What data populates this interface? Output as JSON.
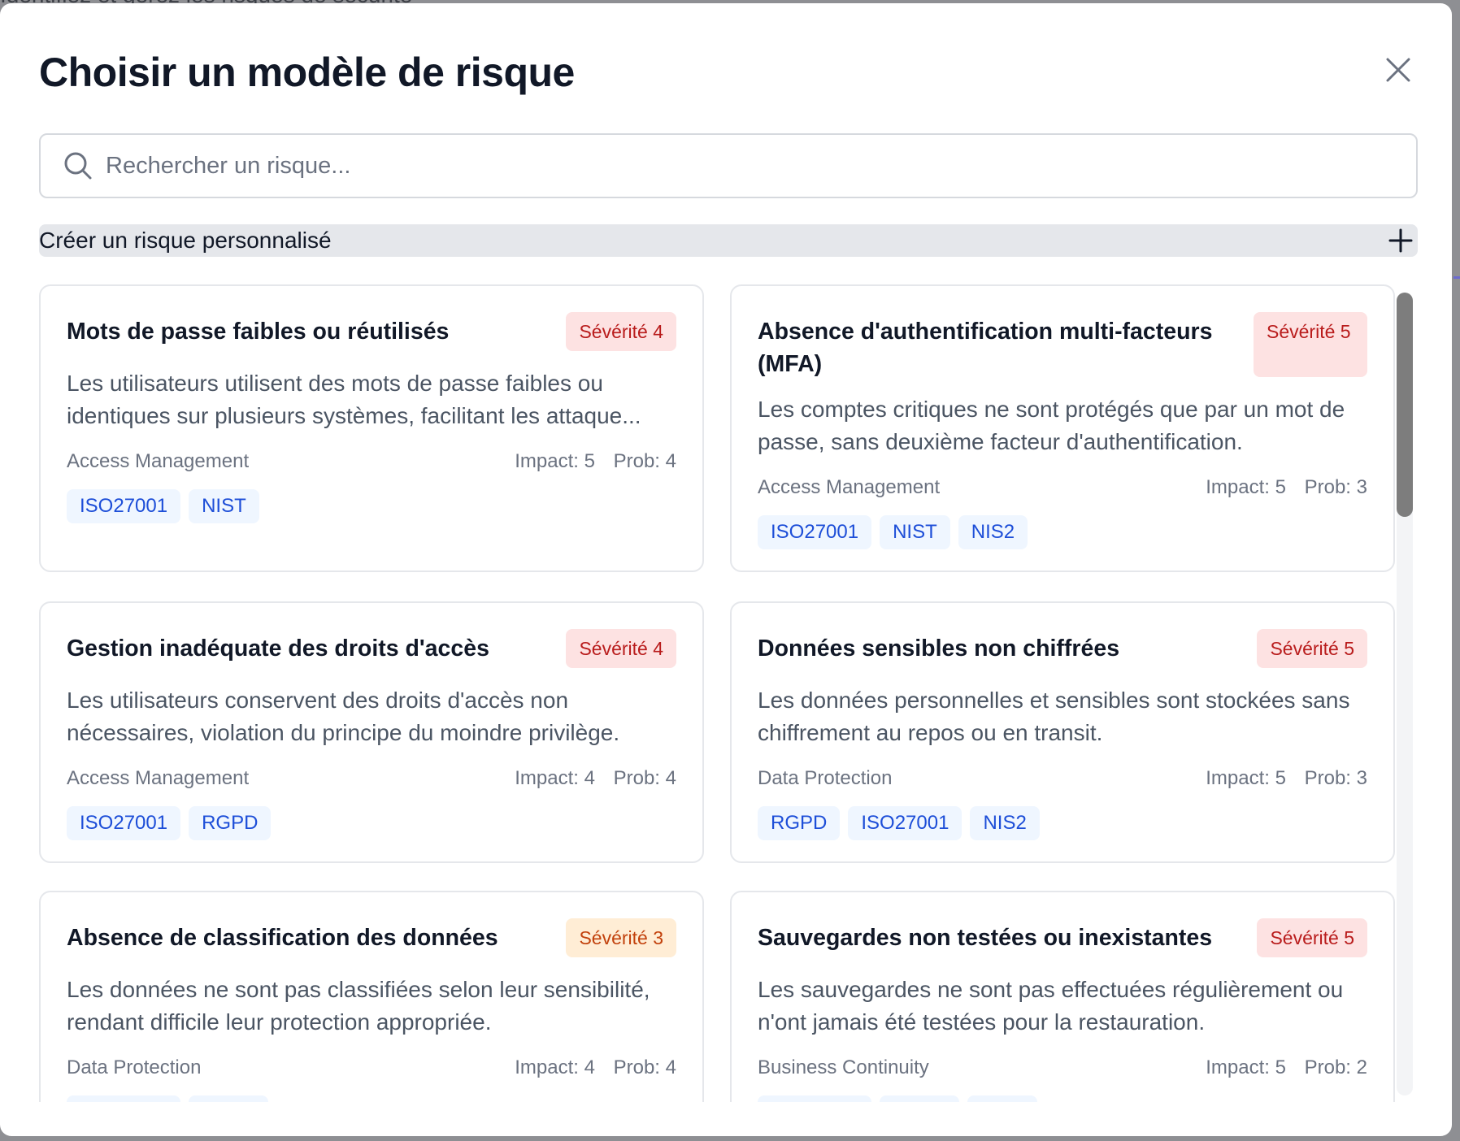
{
  "backdrop": {
    "partial_text": "Identifiez et gérez les risques de sécurité"
  },
  "modal": {
    "title": "Choisir un modèle de risque",
    "close_icon": "close-icon"
  },
  "search": {
    "placeholder": "Rechercher un risque...",
    "value": "",
    "icon": "search-icon"
  },
  "create_custom": {
    "label": "Créer un risque personnalisé",
    "icon": "plus-icon"
  },
  "cards": [
    {
      "title": "Mots de passe faibles ou réutilisés",
      "severity_label": "Sévérité 4",
      "severity_color": "#b91c1c",
      "description": "Les utilisateurs utilisent des mots de passe faibles ou identiques sur plusieurs systèmes, facilitant les attaque...",
      "category": "Access Management",
      "impact": "Impact: 5",
      "prob": "Prob: 4",
      "tags": [
        "ISO27001",
        "NIST"
      ]
    },
    {
      "title": "Absence d'authentification multi-facteurs (MFA)",
      "severity_label": "Sévérité 5",
      "severity_color": "#b91c1c",
      "description": "Les comptes critiques ne sont protégés que par un mot de passe, sans deuxième facteur d'authentification.",
      "category": "Access Management",
      "impact": "Impact: 5",
      "prob": "Prob: 3",
      "tags": [
        "ISO27001",
        "NIST",
        "NIS2"
      ]
    },
    {
      "title": "Gestion inadéquate des droits d'accès",
      "severity_label": "Sévérité 4",
      "severity_color": "#b91c1c",
      "description": "Les utilisateurs conservent des droits d'accès non nécessaires, violation du principe du moindre privilège.",
      "category": "Access Management",
      "impact": "Impact: 4",
      "prob": "Prob: 4",
      "tags": [
        "ISO27001",
        "RGPD"
      ]
    },
    {
      "title": "Données sensibles non chiffrées",
      "severity_label": "Sévérité 5",
      "severity_color": "#b91c1c",
      "description": "Les données personnelles et sensibles sont stockées sans chiffrement au repos ou en transit.",
      "category": "Data Protection",
      "impact": "Impact: 5",
      "prob": "Prob: 3",
      "tags": [
        "RGPD",
        "ISO27001",
        "NIS2"
      ]
    },
    {
      "title": "Absence de classification des données",
      "severity_label": "Sévérité 3",
      "severity_color": "#c2410c",
      "description": "Les données ne sont pas classifiées selon leur sensibilité, rendant difficile leur protection appropriée.",
      "category": "Data Protection",
      "impact": "Impact: 4",
      "prob": "Prob: 4",
      "tags": []
    },
    {
      "title": "Sauvegardes non testées ou inexistantes",
      "severity_label": "Sévérité 5",
      "severity_color": "#b91c1c",
      "description": "Les sauvegardes ne sont pas effectuées régulièrement ou n'ont jamais été testées pour la restauration.",
      "category": "Business Continuity",
      "impact": "Impact: 5",
      "prob": "Prob: 2",
      "tags": []
    }
  ]
}
